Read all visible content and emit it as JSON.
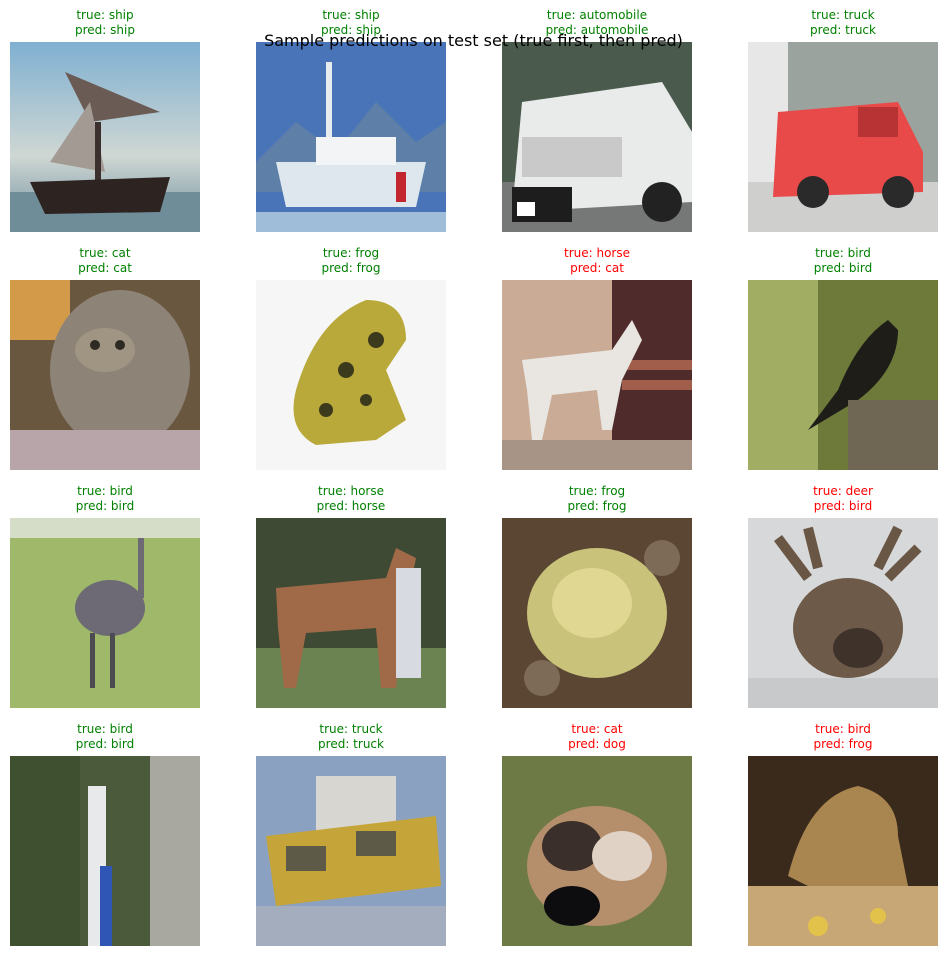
{
  "title": "Sample predictions on test set (true first, then pred)",
  "colors": {
    "correct": "#008000",
    "wrong": "#ff0000"
  },
  "predictions": [
    {
      "true_label": "true: ship",
      "pred_label": "pred: ship",
      "correct": true,
      "thumb_icon": "ship-image"
    },
    {
      "true_label": "true: ship",
      "pred_label": "pred: ship",
      "correct": true,
      "thumb_icon": "ship-image"
    },
    {
      "true_label": "true: automobile",
      "pred_label": "pred: automobile",
      "correct": true,
      "thumb_icon": "automobile-image"
    },
    {
      "true_label": "true: truck",
      "pred_label": "pred: truck",
      "correct": true,
      "thumb_icon": "truck-image"
    },
    {
      "true_label": "true: cat",
      "pred_label": "pred: cat",
      "correct": true,
      "thumb_icon": "cat-image"
    },
    {
      "true_label": "true: frog",
      "pred_label": "pred: frog",
      "correct": true,
      "thumb_icon": "frog-image"
    },
    {
      "true_label": "true: horse",
      "pred_label": "pred: cat",
      "correct": false,
      "thumb_icon": "horse-image"
    },
    {
      "true_label": "true: bird",
      "pred_label": "pred: bird",
      "correct": true,
      "thumb_icon": "bird-image"
    },
    {
      "true_label": "true: bird",
      "pred_label": "pred: bird",
      "correct": true,
      "thumb_icon": "bird-image"
    },
    {
      "true_label": "true: horse",
      "pred_label": "pred: horse",
      "correct": true,
      "thumb_icon": "horse-image"
    },
    {
      "true_label": "true: frog",
      "pred_label": "pred: frog",
      "correct": true,
      "thumb_icon": "frog-image"
    },
    {
      "true_label": "true: deer",
      "pred_label": "pred: bird",
      "correct": false,
      "thumb_icon": "deer-image"
    },
    {
      "true_label": "true: bird",
      "pred_label": "pred: bird",
      "correct": true,
      "thumb_icon": "bird-image"
    },
    {
      "true_label": "true: truck",
      "pred_label": "pred: truck",
      "correct": true,
      "thumb_icon": "truck-image"
    },
    {
      "true_label": "true: cat",
      "pred_label": "pred: dog",
      "correct": false,
      "thumb_icon": "cat-image"
    },
    {
      "true_label": "true: bird",
      "pred_label": "pred: frog",
      "correct": false,
      "thumb_icon": "bird-image"
    }
  ]
}
